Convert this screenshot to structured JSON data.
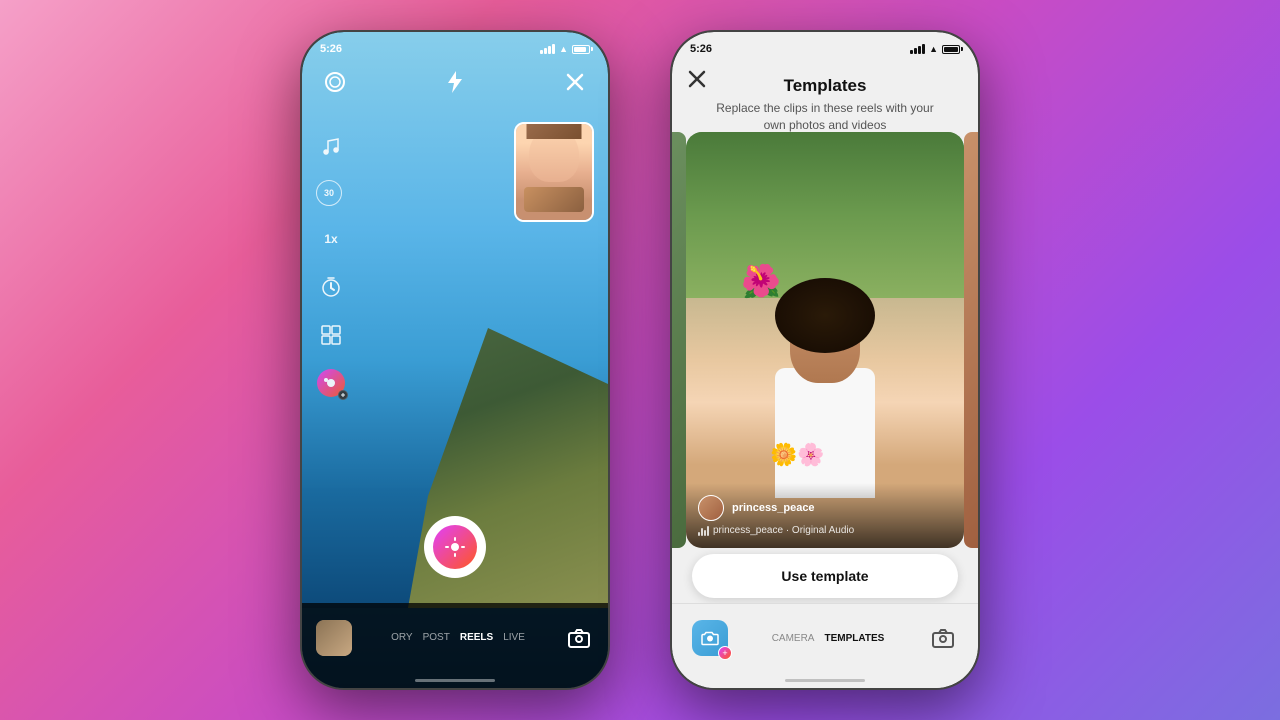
{
  "background": {
    "gradient": "linear-gradient(135deg, #f5a0c8, #e85d9a, #c94cc4, #9b4de8, #7b6ee0)"
  },
  "phone1": {
    "status_bar": {
      "time": "5:26"
    },
    "top_icons": {
      "lens_icon": "◎",
      "flash_icon": "⚡",
      "close_icon": "✕"
    },
    "side_toolbar": {
      "music_icon": "♫",
      "timer_label": "30",
      "speed_label": "1x",
      "countdown_icon": "⊙",
      "layout_icon": "⊞",
      "effects_icon": "📷"
    },
    "bottom_nav": {
      "tabs": [
        "ORY",
        "POST",
        "REELS",
        "LIVE"
      ],
      "active_tab": "REELS"
    }
  },
  "phone2": {
    "status_bar": {
      "time": "5:26"
    },
    "header": {
      "title": "Templates",
      "subtitle": "Replace the clips in these reels with your\nown photos and videos",
      "close_icon": "✕"
    },
    "video": {
      "username": "princess_peace",
      "audio": "princess_peace · Original Audio"
    },
    "use_template_button": "Use template",
    "bottom_nav": {
      "tabs": [
        "CAMERA",
        "TEMPLATES"
      ],
      "active_tab": "TEMPLATES"
    }
  }
}
